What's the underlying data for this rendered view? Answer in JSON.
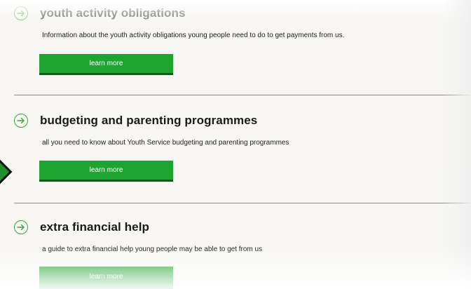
{
  "sections": [
    {
      "title": "youth activity obligations",
      "description": "Information about the youth activity obligations young people need to do to get payments from us.",
      "button_label": "learn more",
      "icon": "arrow-right-circle-icon"
    },
    {
      "title": "budgeting and parenting programmes",
      "description": "all you need to know about Youth Service budgeting and parenting programmes",
      "button_label": "learn more",
      "icon": "arrow-right-circle-icon"
    },
    {
      "title": "extra financial help",
      "description": "a guide to extra financial help young people may be able to get from us",
      "button_label": "learn more",
      "icon": "arrow-right-circle-icon"
    }
  ],
  "colors": {
    "accent": "#3aa63f",
    "button": "#1ea531",
    "button_shadow": "#0d5c1a",
    "divider": "#8c8c8c",
    "background": "#f7f6f3"
  }
}
